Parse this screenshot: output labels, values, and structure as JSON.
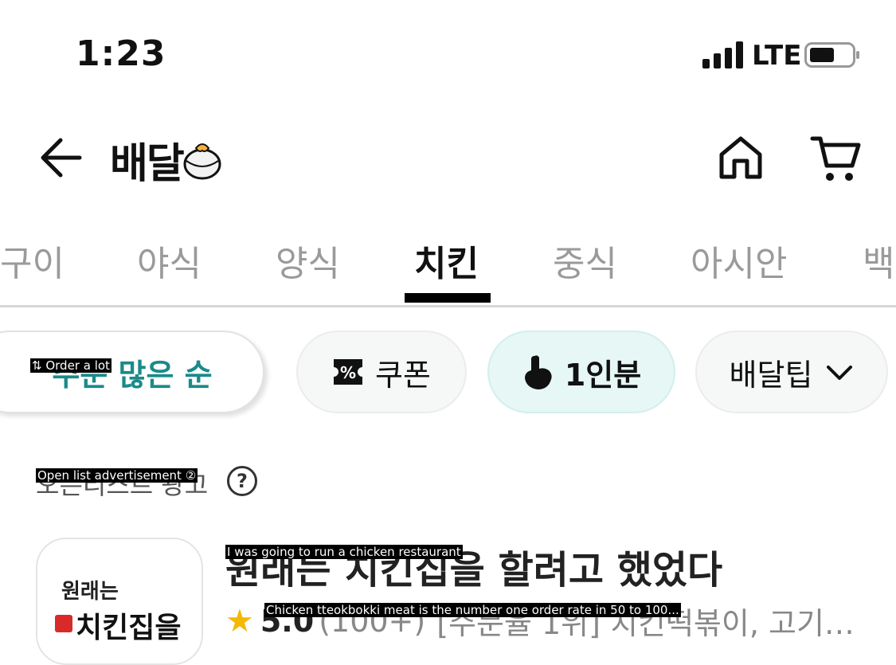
{
  "status": {
    "time": "1:23",
    "network": "LTE"
  },
  "header": {
    "brand": "배달"
  },
  "categories": {
    "tabs": [
      "구이",
      "야식",
      "양식",
      "치킨",
      "중식",
      "아시안",
      "백"
    ],
    "active": "치킨"
  },
  "filters": {
    "sort_label": "주문 많은 순",
    "sort_overlay": "⇅ Order a lot",
    "coupon_label": "쿠폰",
    "single_label": "1인분",
    "tip_label": "배달팁"
  },
  "ad": {
    "label": "오픈리스트 광고",
    "overlay": "Open list advertisement ②",
    "help": "?"
  },
  "store": {
    "name": "원래는 치킨집을 할려고 했었다",
    "name_overlay": "I was going to run a chicken restaurant",
    "thumb_line1": "원래는",
    "thumb_line2": "치킨집을",
    "rating": "5.0",
    "reviews": "(100+)",
    "desc": "[주문율 1위] 치킨떡볶이, 고기…",
    "desc_overlay": "Chicken tteokbokki meat is the number one order rate in 50 to 100..."
  },
  "colors": {
    "accent_teal": "#1a8a8a",
    "star": "#f5b800",
    "chip_selected_bg": "#e6f7f6"
  }
}
